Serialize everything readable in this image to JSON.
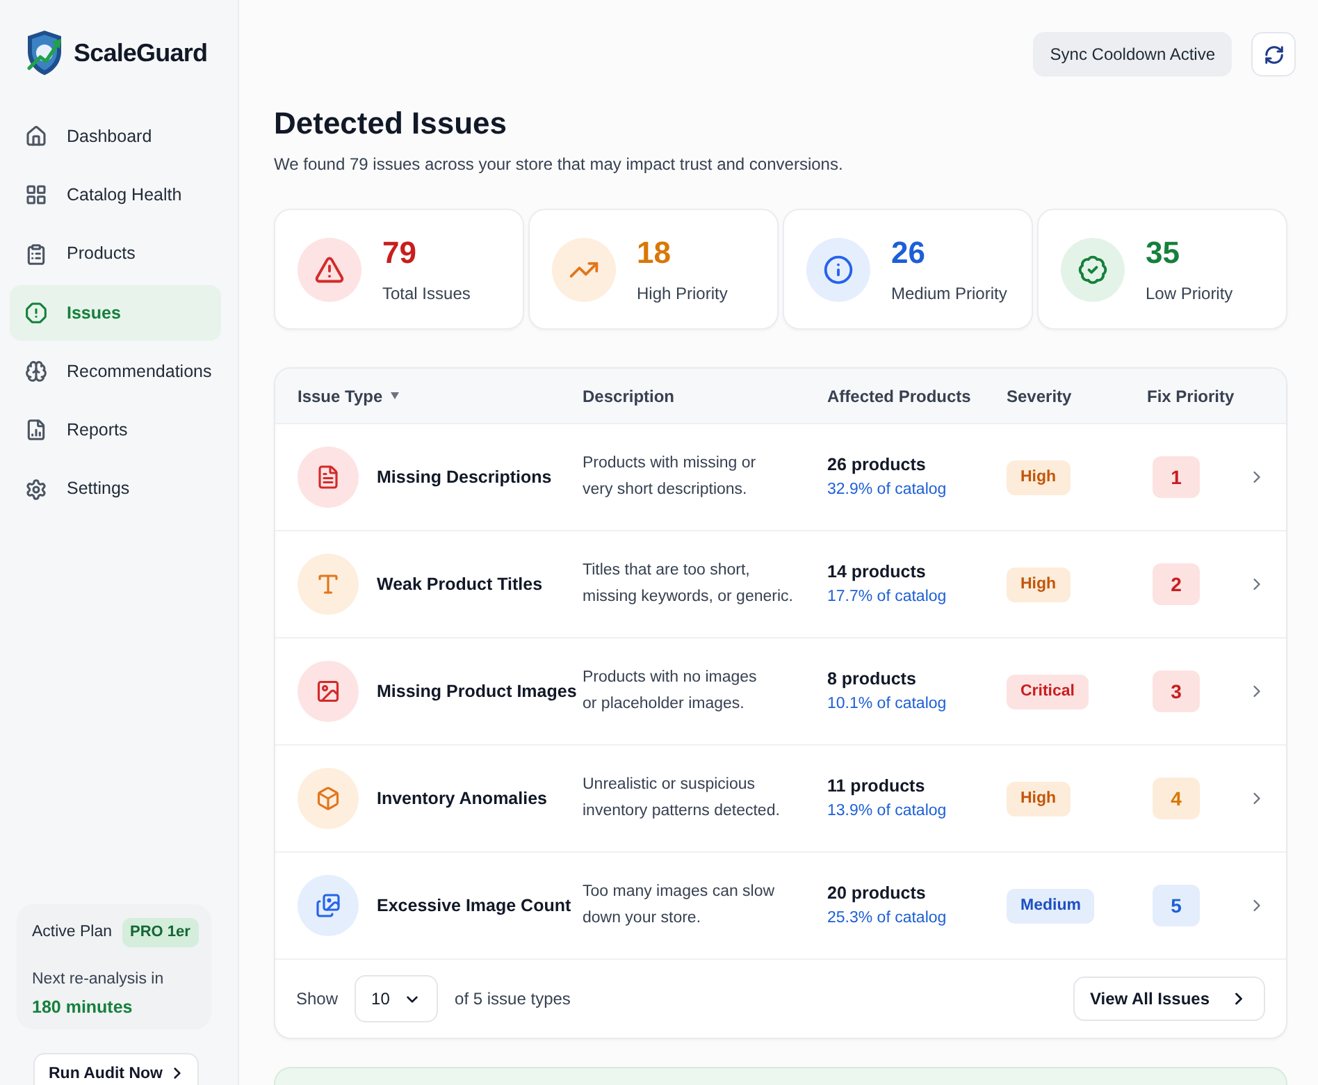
{
  "brand": {
    "name": "ScaleGuard"
  },
  "sidebar": {
    "items": [
      {
        "label": "Dashboard",
        "selected": false
      },
      {
        "label": "Catalog Health",
        "selected": false
      },
      {
        "label": "Products",
        "selected": false
      },
      {
        "label": "Issues",
        "selected": true
      },
      {
        "label": "Recommendations",
        "selected": false
      },
      {
        "label": "Reports",
        "selected": false
      },
      {
        "label": "Settings",
        "selected": false
      }
    ],
    "plan": {
      "label": "Active Plan",
      "badge": "PRO 1er",
      "next_label": "Next re-analysis in",
      "next_value": "180 minutes"
    },
    "run_audit_button": "Run Audit Now"
  },
  "header": {
    "sync_button": "Sync Cooldown Active"
  },
  "page": {
    "title": "Detected Issues",
    "subtitle": "We found 79 issues across your store that may impact trust and conversions."
  },
  "stats": [
    {
      "kind": "total",
      "value": "79",
      "label": "Total Issues"
    },
    {
      "kind": "high",
      "value": "18",
      "label": "High Priority"
    },
    {
      "kind": "medium",
      "value": "26",
      "label": "Medium Priority"
    },
    {
      "kind": "low",
      "value": "35",
      "label": "Low Priority"
    }
  ],
  "table": {
    "columns": [
      {
        "label": "Issue Type",
        "sorted": true
      },
      {
        "label": "Description",
        "sorted": false
      },
      {
        "label": "Affected Products",
        "sorted": false
      },
      {
        "label": "Severity",
        "sorted": false
      },
      {
        "label": "Fix Priority",
        "sorted": false
      }
    ],
    "rows": [
      {
        "kind": "descriptions",
        "name": "Missing Descriptions",
        "description": "Products with missing or\nvery short descriptions.",
        "products": "26 products",
        "share": "32.9% of catalog",
        "severity": {
          "label": "High",
          "kind": "high"
        },
        "priority": {
          "label": "1",
          "kind": "critical"
        }
      },
      {
        "kind": "titles",
        "name": "Weak Product Titles",
        "description": "Titles that are too short,\nmissing keywords, or generic.",
        "products": "14 products",
        "share": "17.7% of catalog",
        "severity": {
          "label": "High",
          "kind": "high"
        },
        "priority": {
          "label": "2",
          "kind": "critical"
        }
      },
      {
        "kind": "images",
        "name": "Missing Product Images",
        "description": "Products with no images\nor placeholder images.",
        "products": "8 products",
        "share": "10.1% of catalog",
        "severity": {
          "label": "Critical",
          "kind": "critical"
        },
        "priority": {
          "label": "3",
          "kind": "critical"
        }
      },
      {
        "kind": "inventory",
        "name": "Inventory Anomalies",
        "description": "Unrealistic or suspicious\ninventory patterns detected.",
        "products": "11 products",
        "share": "13.9% of catalog",
        "severity": {
          "label": "High",
          "kind": "high"
        },
        "priority": {
          "label": "4",
          "kind": "high"
        }
      },
      {
        "kind": "image_count",
        "name": "Excessive Image Count",
        "description": "Too many images can slow\ndown your store.",
        "products": "20 products",
        "share": "25.3% of catalog",
        "severity": {
          "label": "Medium",
          "kind": "medium"
        },
        "priority": {
          "label": "5",
          "kind": "medium"
        }
      }
    ],
    "footer": {
      "show_label": "Show",
      "page_size": "10",
      "count_text": "of 5 issue types",
      "view_all_button": "View All Issues"
    }
  }
}
